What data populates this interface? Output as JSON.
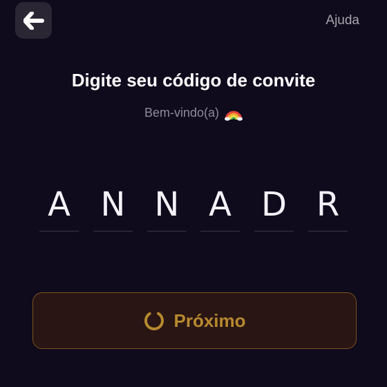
{
  "header": {
    "back_icon": "arrow-left-icon",
    "help_label": "Ajuda"
  },
  "main": {
    "title": "Digite seu código de convite",
    "subtitle": "Bem-vindo(a)",
    "subtitle_icon": "rainbow-icon",
    "code": [
      "A",
      "N",
      "N",
      "A",
      "D",
      "R"
    ]
  },
  "footer": {
    "next_label": "Próximo",
    "next_icon": "spinner-icon"
  },
  "colors": {
    "background": "#0f0a1c",
    "button_bg": "#291513",
    "button_border": "#7a5420",
    "accent": "#b6892f",
    "muted_text": "#8e8b98"
  }
}
